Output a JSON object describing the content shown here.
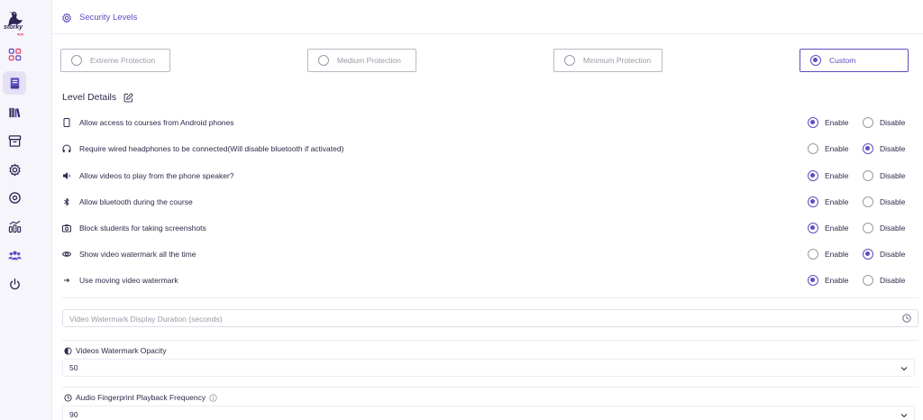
{
  "brand": {
    "logo_text": "storky",
    "logo_sub": "app"
  },
  "sidebar": {
    "items": [
      {
        "name": "dashboard",
        "icon": "grid-icon"
      },
      {
        "name": "courses",
        "icon": "book-icon",
        "active": true
      },
      {
        "name": "library",
        "icon": "library-icon"
      },
      {
        "name": "archive",
        "icon": "archive-icon"
      },
      {
        "name": "settings",
        "icon": "gear-icon"
      },
      {
        "name": "record",
        "icon": "target-icon"
      },
      {
        "name": "analytics",
        "icon": "chart-icon"
      },
      {
        "name": "users",
        "icon": "users-icon"
      },
      {
        "name": "logout",
        "icon": "power-icon"
      }
    ]
  },
  "header": {
    "title": "Security Levels"
  },
  "levels": [
    {
      "label": "Extreme Protection",
      "selected": false
    },
    {
      "label": "Medium Protection",
      "selected": false
    },
    {
      "label": "Minimum Protection",
      "selected": false
    },
    {
      "label": "Custom",
      "selected": true
    }
  ],
  "details": {
    "title": "Level Details",
    "enable_label": "Enable",
    "disable_label": "Disable",
    "settings": [
      {
        "icon": "phone-icon",
        "label": "Allow access to courses from Android phones",
        "value": "enable"
      },
      {
        "icon": "headphones-icon",
        "label": "Require wired headphones to be connected(Will disable bluetooth if activated)",
        "value": "disable"
      },
      {
        "icon": "speaker-icon",
        "label": "Allow videos to play from the phone speaker?",
        "value": "enable"
      },
      {
        "icon": "bluetooth-icon",
        "label": "Allow bluetooth during the course",
        "value": "enable"
      },
      {
        "icon": "camera-icon",
        "label": "Block students for taking screenshots",
        "value": "enable"
      },
      {
        "icon": "eye-icon",
        "label": "Show video watermark all the time",
        "value": "disable"
      },
      {
        "icon": "arrow-right-icon",
        "label": "Use moving video watermark",
        "value": "enable"
      }
    ]
  },
  "watermark_duration": {
    "placeholder": "Video Watermark Display Duration (seconds)",
    "value": ""
  },
  "watermark_opacity": {
    "label": "Videos Watermark Opacity",
    "value": "50"
  },
  "audio_fingerprint": {
    "label": "Audio Fingerprint Playback Frequency",
    "value": "90"
  },
  "colors": {
    "accent": "#5a4fc0",
    "text": "#2f2a4a",
    "muted": "#9b9aa8"
  }
}
